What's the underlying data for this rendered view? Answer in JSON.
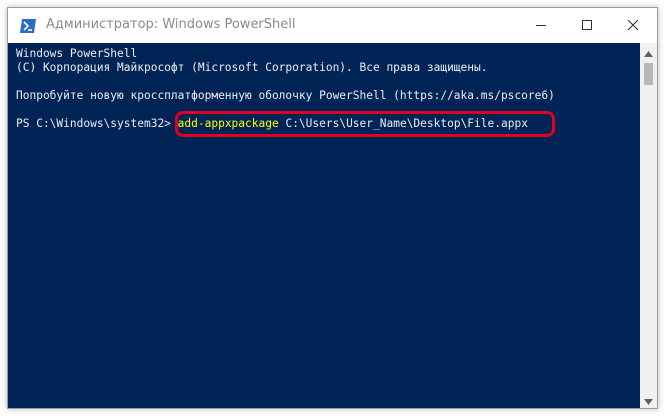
{
  "window": {
    "title": "Администратор: Windows PowerShell",
    "icon": "powershell-icon",
    "controls": [
      "minimize-icon",
      "maximize-icon",
      "close-icon"
    ]
  },
  "console": {
    "lines": [
      "Windows PowerShell",
      "(C) Корпорация Майкрософт (Microsoft Corporation). Все права защищены.",
      "",
      "Попробуйте новую кроссплатформенную оболочку PowerShell (https://aka.ms/pscore6)",
      ""
    ],
    "prompt": "PS C:\\Windows\\system32>",
    "command": "add-appxpackage",
    "argument": " C:\\Users\\User_Name\\Desktop\\File.appx"
  },
  "colors": {
    "console_background": "#012456",
    "console_text": "#eeedf0",
    "command_text": "#ffff00",
    "highlight_border": "#e3001b"
  }
}
